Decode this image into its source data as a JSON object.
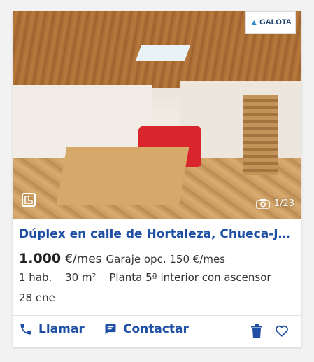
{
  "listing": {
    "brand": "GALOTA",
    "photo_counter": "1/23",
    "title": "Dúplex en calle de Hortaleza, Chueca-Jus…",
    "price": "1.000",
    "price_unit": "€/mes",
    "extra_price": "Garaje opc. 150 €/mes",
    "rooms": "1 hab.",
    "size": "30 m²",
    "floor": "Planta 5ª interior con ascensor",
    "date": "28 ene"
  },
  "actions": {
    "call_label": "Llamar",
    "contact_label": "Contactar"
  },
  "icons": {
    "call": "phone-icon",
    "contact": "chat-icon",
    "delete": "trash-icon",
    "favorite": "heart-icon",
    "camera": "camera-icon",
    "plan": "floorplan-icon"
  },
  "colors": {
    "accent": "#1f4fa5",
    "card_bg": "#ffffff",
    "page_bg": "#f2f2f2"
  }
}
